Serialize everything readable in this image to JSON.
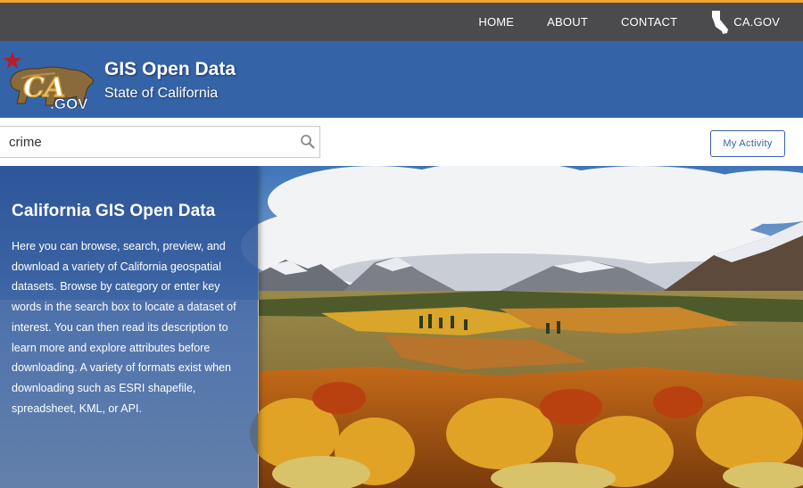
{
  "nav": {
    "items": [
      {
        "label": "HOME"
      },
      {
        "label": "ABOUT"
      },
      {
        "label": "CONTACT"
      },
      {
        "label": "CA.GOV",
        "icon": "california-state-icon"
      }
    ]
  },
  "header": {
    "logo_text": "CA.GOV",
    "title": "GIS Open Data",
    "subtitle": "State of California"
  },
  "search": {
    "value": "crime",
    "icon": "search-icon"
  },
  "actions": {
    "my_activity_label": "My Activity"
  },
  "intro": {
    "title": "California GIS Open Data",
    "body": "Here you can browse, search, preview, and download a variety of California geospatial datasets. Browse by category or enter key words in the search box to locate a dataset of interest. You can then read its description to learn more and explore attributes before downloading. A variety of formats exist when downloading such as ESRI shapefile, spreadsheet, KML, or API."
  },
  "colors": {
    "topbar": "#4b4b4d",
    "topbar_accent": "#f2a52a",
    "banner": "#3563a8",
    "button_border": "#3563a8"
  }
}
